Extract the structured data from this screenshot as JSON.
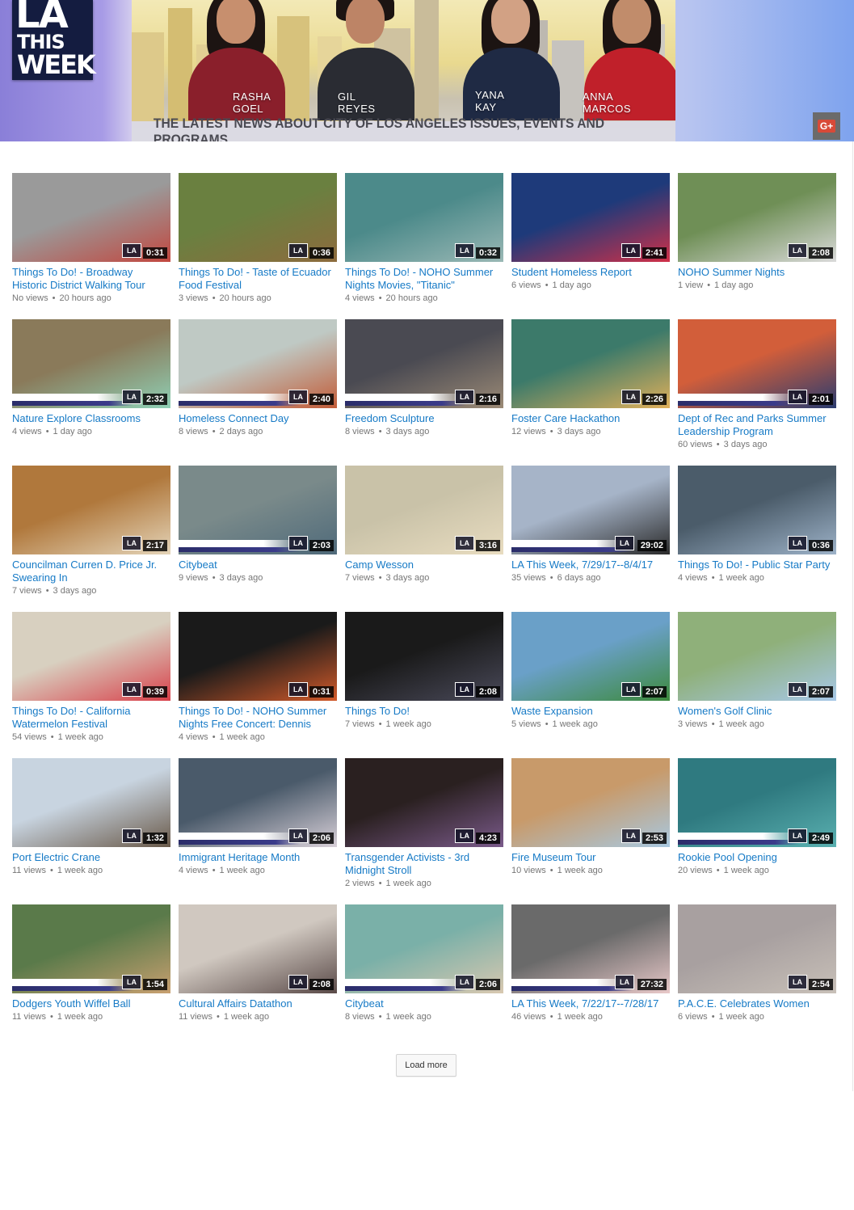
{
  "banner": {
    "logo_line1": "LA",
    "logo_line2": "THIS",
    "logo_line3": "WEEK",
    "tagline": "THE LATEST NEWS ABOUT CITY OF LOS ANGELES ISSUES, EVENTS AND PROGRAMS",
    "hosts": [
      {
        "name": "RASHA\nGOEL"
      },
      {
        "name": "GIL\nREYES"
      },
      {
        "name": "YANA\nKAY"
      },
      {
        "name": "ANNA\nMARCOS"
      }
    ],
    "share_label": "G+",
    "share_icon": "google-plus-icon"
  },
  "colors": {
    "link": "#167ac6",
    "meta": "#767676",
    "duration_bg": "#000000"
  },
  "videos": [
    {
      "title": "Things To Do! - Broadway Historic District Walking Tour",
      "views": "No views",
      "age": "20 hours ago",
      "duration": "0:31"
    },
    {
      "title": "Things To Do! - Taste of Ecuador Food Festival",
      "views": "3 views",
      "age": "20 hours ago",
      "duration": "0:36"
    },
    {
      "title": "Things To Do! - NOHO Summer Nights Movies, \"Titanic\"",
      "views": "4 views",
      "age": "20 hours ago",
      "duration": "0:32"
    },
    {
      "title": "Student Homeless Report",
      "views": "6 views",
      "age": "1 day ago",
      "duration": "2:41"
    },
    {
      "title": "NOHO Summer Nights",
      "views": "1 view",
      "age": "1 day ago",
      "duration": "2:08"
    },
    {
      "title": "Nature Explore Classrooms",
      "views": "4 views",
      "age": "1 day ago",
      "duration": "2:32"
    },
    {
      "title": "Homeless Connect Day",
      "views": "8 views",
      "age": "2 days ago",
      "duration": "2:40"
    },
    {
      "title": "Freedom Sculpture",
      "views": "8 views",
      "age": "3 days ago",
      "duration": "2:16"
    },
    {
      "title": "Foster Care Hackathon",
      "views": "12 views",
      "age": "3 days ago",
      "duration": "2:26"
    },
    {
      "title": "Dept of Rec and Parks Summer Leadership Program",
      "views": "60 views",
      "age": "3 days ago",
      "duration": "2:01"
    },
    {
      "title": "Councilman Curren D. Price Jr. Swearing In",
      "views": "7 views",
      "age": "3 days ago",
      "duration": "2:17"
    },
    {
      "title": "Citybeat",
      "views": "9 views",
      "age": "3 days ago",
      "duration": "2:03"
    },
    {
      "title": "Camp Wesson",
      "views": "7 views",
      "age": "3 days ago",
      "duration": "3:16"
    },
    {
      "title": "LA This Week, 7/29/17--8/4/17",
      "views": "35 views",
      "age": "6 days ago",
      "duration": "29:02"
    },
    {
      "title": "Things To Do! - Public Star Party",
      "views": "4 views",
      "age": "1 week ago",
      "duration": "0:36"
    },
    {
      "title": "Things To Do! - California Watermelon Festival",
      "views": "54 views",
      "age": "1 week ago",
      "duration": "0:39"
    },
    {
      "title": "Things To Do! - NOHO Summer Nights Free Concert: Dennis",
      "views": "4 views",
      "age": "1 week ago",
      "duration": "0:31"
    },
    {
      "title": "Things To Do!",
      "views": "7 views",
      "age": "1 week ago",
      "duration": "2:08"
    },
    {
      "title": "Waste Expansion",
      "views": "5 views",
      "age": "1 week ago",
      "duration": "2:07"
    },
    {
      "title": "Women's Golf Clinic",
      "views": "3 views",
      "age": "1 week ago",
      "duration": "2:07"
    },
    {
      "title": "Port Electric Crane",
      "views": "11 views",
      "age": "1 week ago",
      "duration": "1:32"
    },
    {
      "title": "Immigrant Heritage Month",
      "views": "4 views",
      "age": "1 week ago",
      "duration": "2:06"
    },
    {
      "title": "Transgender Activists - 3rd Midnight Stroll",
      "views": "2 views",
      "age": "1 week ago",
      "duration": "4:23"
    },
    {
      "title": "Fire Museum Tour",
      "views": "10 views",
      "age": "1 week ago",
      "duration": "2:53"
    },
    {
      "title": "Rookie Pool Opening",
      "views": "20 views",
      "age": "1 week ago",
      "duration": "2:49"
    },
    {
      "title": "Dodgers Youth Wiffel Ball",
      "views": "11 views",
      "age": "1 week ago",
      "duration": "1:54"
    },
    {
      "title": "Cultural Affairs Datathon",
      "views": "11 views",
      "age": "1 week ago",
      "duration": "2:08"
    },
    {
      "title": "Citybeat",
      "views": "8 views",
      "age": "1 week ago",
      "duration": "2:06"
    },
    {
      "title": "LA This Week, 7/22/17--7/28/17",
      "views": "46 views",
      "age": "1 week ago",
      "duration": "27:32"
    },
    {
      "title": "P.A.C.E. Celebrates Women",
      "views": "6 views",
      "age": "1 week ago",
      "duration": "2:54"
    }
  ],
  "load_more_label": "Load more",
  "thumb_watermark": "LA"
}
